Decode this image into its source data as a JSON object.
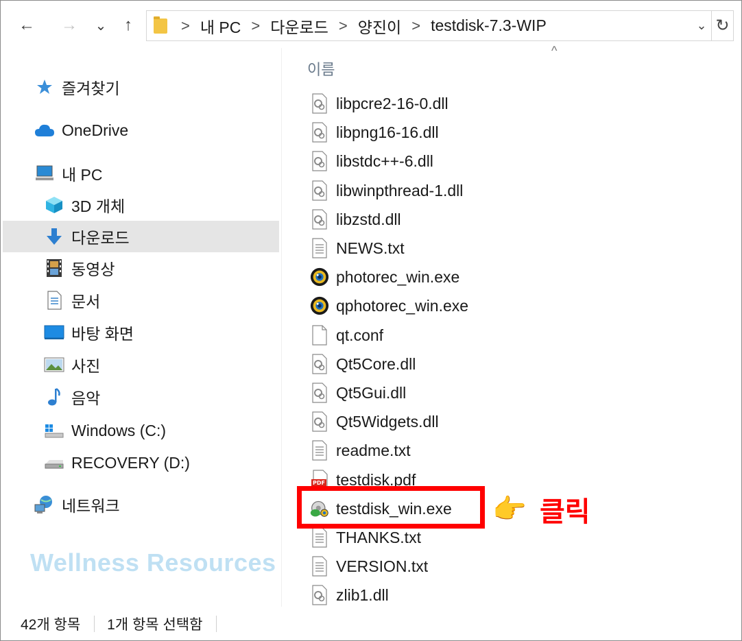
{
  "toolbar": {
    "back_icon": "←",
    "forward_icon": "→",
    "recent_icon": "⌄",
    "up_icon": "↑"
  },
  "address": {
    "crumbs": [
      "내 PC",
      "다운로드",
      "양진이",
      "testdisk-7.3-WIP"
    ],
    "separator": ">",
    "dropdown_icon": "⌄",
    "refresh_icon": "↻"
  },
  "sidebar": {
    "items": [
      {
        "label": "즐겨찾기",
        "icon": "star-icon"
      },
      {
        "label": "OneDrive",
        "icon": "cloud-icon"
      },
      {
        "label": "내 PC",
        "icon": "computer-icon"
      },
      {
        "label": "3D 개체",
        "icon": "cube-icon"
      },
      {
        "label": "다운로드",
        "icon": "download-arrow-icon"
      },
      {
        "label": "동영상",
        "icon": "film-icon"
      },
      {
        "label": "문서",
        "icon": "document-icon"
      },
      {
        "label": "바탕 화면",
        "icon": "desktop-icon"
      },
      {
        "label": "사진",
        "icon": "picture-icon"
      },
      {
        "label": "음악",
        "icon": "music-note-icon"
      },
      {
        "label": "Windows (C:)",
        "icon": "windows-drive-icon"
      },
      {
        "label": "RECOVERY (D:)",
        "icon": "drive-icon"
      },
      {
        "label": "네트워크",
        "icon": "network-icon"
      }
    ],
    "selected": "다운로드"
  },
  "watermark": "Wellness Resources",
  "file_list": {
    "column_name": "이름",
    "sort_indicator": "^",
    "files": [
      {
        "name": "libpcre2-16-0.dll",
        "type": "dll"
      },
      {
        "name": "libpng16-16.dll",
        "type": "dll"
      },
      {
        "name": "libstdc++-6.dll",
        "type": "dll"
      },
      {
        "name": "libwinpthread-1.dll",
        "type": "dll"
      },
      {
        "name": "libzstd.dll",
        "type": "dll"
      },
      {
        "name": "NEWS.txt",
        "type": "txt"
      },
      {
        "name": "photorec_win.exe",
        "type": "photorec"
      },
      {
        "name": "qphotorec_win.exe",
        "type": "photorec"
      },
      {
        "name": "qt.conf",
        "type": "blank"
      },
      {
        "name": "Qt5Core.dll",
        "type": "dll"
      },
      {
        "name": "Qt5Gui.dll",
        "type": "dll"
      },
      {
        "name": "Qt5Widgets.dll",
        "type": "dll"
      },
      {
        "name": "readme.txt",
        "type": "txt"
      },
      {
        "name": "testdisk.pdf",
        "type": "pdf"
      },
      {
        "name": "testdisk_win.exe",
        "type": "testdisk"
      },
      {
        "name": "THANKS.txt",
        "type": "txt"
      },
      {
        "name": "VERSION.txt",
        "type": "txt"
      },
      {
        "name": "zlib1.dll",
        "type": "dll"
      }
    ]
  },
  "annotation": {
    "click_label": "클릭",
    "pointer": "👉"
  },
  "status": {
    "item_count": "42개 항목",
    "selected_count": "1개 항목 선택함"
  },
  "colors": {
    "highlight": "#ff0000",
    "selected_bg": "#e5e5e5",
    "watermark": "#bfe0f3"
  }
}
